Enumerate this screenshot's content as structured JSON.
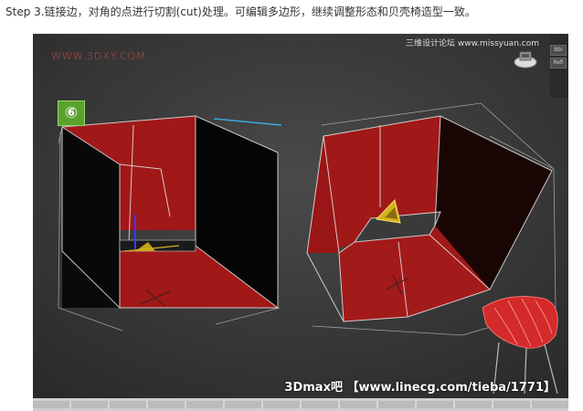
{
  "caption": "Step 3.链接边，对角的点进行切割(cut)处理。可编辑多边形，继续调整形态和贝壳椅造型一致。",
  "viewport": {
    "watermark": "WWW.3DXY.COM",
    "site_label": "三维设计论坛 www.missyuan.com",
    "step_badge": "⑥",
    "panel_buttons": [
      "Bbi",
      "Refi"
    ],
    "footer": "3Dmax吧 【www.linecg.com/tieba/1771】"
  },
  "colors": {
    "background": "#3a3a3a",
    "face_red": "#a01818",
    "face_dark": "#0a0a0a",
    "wire": "#e6e6e6",
    "badge": "#5aa22e",
    "gizmo": "#d4b21a",
    "chair": "#d42a2a"
  },
  "icons": [
    "steering-wheel-icon",
    "move-gizmo-icon",
    "triangle-gizmo-icon"
  ]
}
